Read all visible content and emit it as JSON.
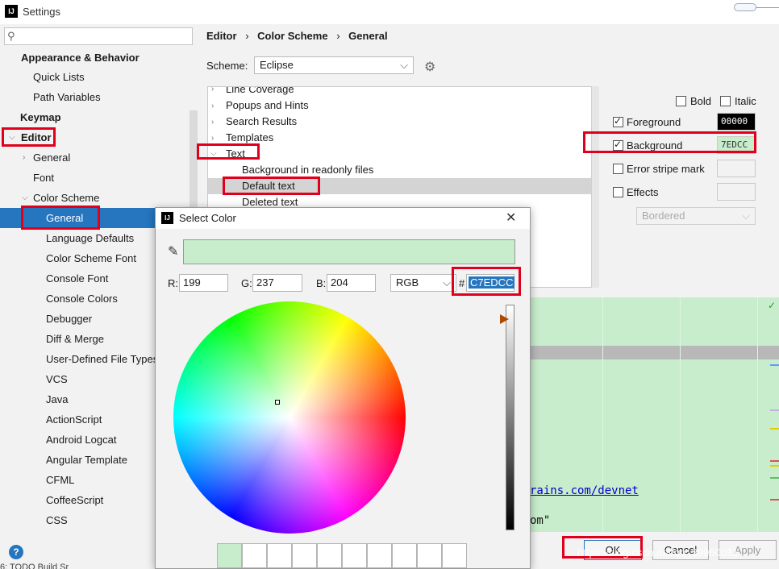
{
  "window": {
    "title": "Settings",
    "icon_text": "IJ"
  },
  "search": {
    "placeholder": ""
  },
  "sidebar": {
    "items": [
      {
        "label": "Appearance & Behavior"
      },
      {
        "label": "Quick Lists"
      },
      {
        "label": "Path Variables"
      },
      {
        "label": "Keymap"
      },
      {
        "label": "Editor"
      },
      {
        "label": "General"
      },
      {
        "label": "Font"
      },
      {
        "label": "Color Scheme"
      },
      {
        "label": "General"
      },
      {
        "label": "Language Defaults"
      },
      {
        "label": "Color Scheme Font"
      },
      {
        "label": "Console Font"
      },
      {
        "label": "Console Colors"
      },
      {
        "label": "Debugger"
      },
      {
        "label": "Diff & Merge"
      },
      {
        "label": "User-Defined File Types"
      },
      {
        "label": "VCS"
      },
      {
        "label": "Java"
      },
      {
        "label": "ActionScript"
      },
      {
        "label": "Android Logcat"
      },
      {
        "label": "Angular Template"
      },
      {
        "label": "CFML"
      },
      {
        "label": "CoffeeScript"
      },
      {
        "label": "CSS"
      }
    ]
  },
  "breadcrumb": {
    "part1": "Editor",
    "part2": "Color Scheme",
    "part3": "General",
    "sep": "›"
  },
  "scheme": {
    "label": "Scheme:",
    "value": "Eclipse"
  },
  "attributes": {
    "items": [
      {
        "label": "Line Coverage"
      },
      {
        "label": "Popups and Hints"
      },
      {
        "label": "Search Results"
      },
      {
        "label": "Templates"
      },
      {
        "label": "Text"
      },
      {
        "label": "Background in readonly files"
      },
      {
        "label": "Default text"
      },
      {
        "label": "Deleted text"
      }
    ]
  },
  "options": {
    "bold": "Bold",
    "italic": "Italic",
    "foreground": "Foreground",
    "foreground_value": "00000",
    "background": "Background",
    "background_value": "7EDCC",
    "error_stripe": "Error stripe mark",
    "effects": "Effects",
    "effects_style": "Bordered"
  },
  "preview": {
    "link_text": "rains.com/devnet",
    "code_text": "om\""
  },
  "buttons": {
    "ok": "OK",
    "cancel": "Cancel",
    "apply": "Apply"
  },
  "watermark": "https://blog.csdn.net/qq_39960031",
  "dialog": {
    "title": "Select Color",
    "icon_text": "IJ",
    "r_label": "R:",
    "r_value": "199",
    "g_label": "G:",
    "g_value": "237",
    "b_label": "B:",
    "b_value": "204",
    "mode": "RGB",
    "hash": "#",
    "hex": "C7EDCC"
  },
  "bottom_tabs": "6: TODO   Build   Sr",
  "colors": {
    "accent": "#2675bf",
    "selected_color": "#c7edcc",
    "highlight_border": "#e0001b"
  }
}
